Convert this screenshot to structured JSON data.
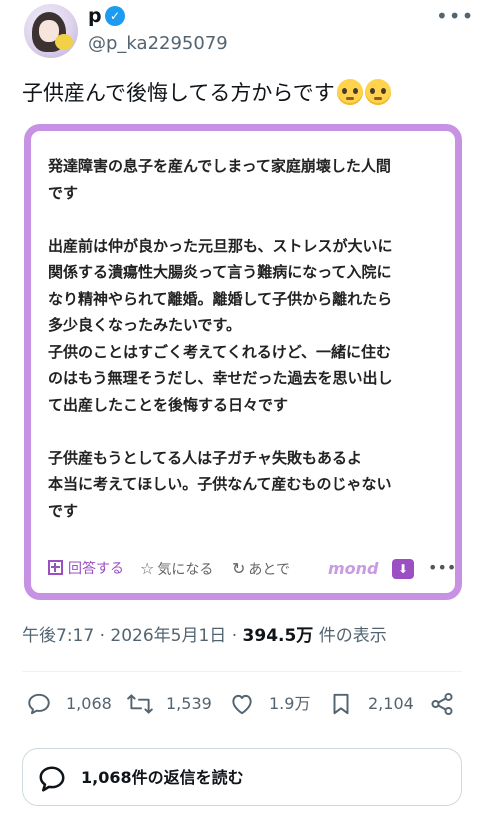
{
  "author": {
    "display_name": "p",
    "handle": "@p_ka2295079",
    "verified_glyph": "✓"
  },
  "header": {
    "more_glyph": "•••"
  },
  "tweet": {
    "text": "子供産んで後悔してる方からです"
  },
  "card": {
    "body": "発達障害の息子を産んでしまって家庭崩壊した人間\nです\n\n出産前は仲が良かった元旦那も、ストレスが大いに\n関係する潰瘍性大腸炎って言う難病になって入院に\nなり精神やられて離婚。離婚して子供から離れたら\n多少良くなったみたいです。\n子供のことはすごく考えてくれるけど、一緒に住む\nのはもう無理そうだし、幸せだった過去を思い出し\nて出産したことを後悔する日々です\n\n子供産もうとしてる人は子ガチャ失敗もあるよ\n本当に考えてほしい。子供なんて産むものじゃない\nです",
    "answer_label": "回答する",
    "favorite_label": "気になる",
    "later_label": "あとで",
    "favorite_glyph": "☆",
    "later_glyph": "↻",
    "logo_text": "mond",
    "download_glyph": "⬇",
    "more_glyph": "•••",
    "accent_color": "#c792e3"
  },
  "meta": {
    "time": "午後7:17",
    "sep1": "·",
    "date": "2026年5月1日",
    "sep2": "·",
    "views": "394.5万",
    "views_label": "件の表示"
  },
  "stats": {
    "replies": "1,068",
    "retweets": "1,539",
    "likes": "1.9万",
    "bookmarks": "2,104"
  },
  "icons": {
    "reply": "reply-icon",
    "retweet": "retweet-icon",
    "like": "heart-icon",
    "bookmark": "bookmark-icon",
    "share": "share-icon"
  },
  "footer": {
    "read_replies_label": "1,068件の返信を読む"
  }
}
